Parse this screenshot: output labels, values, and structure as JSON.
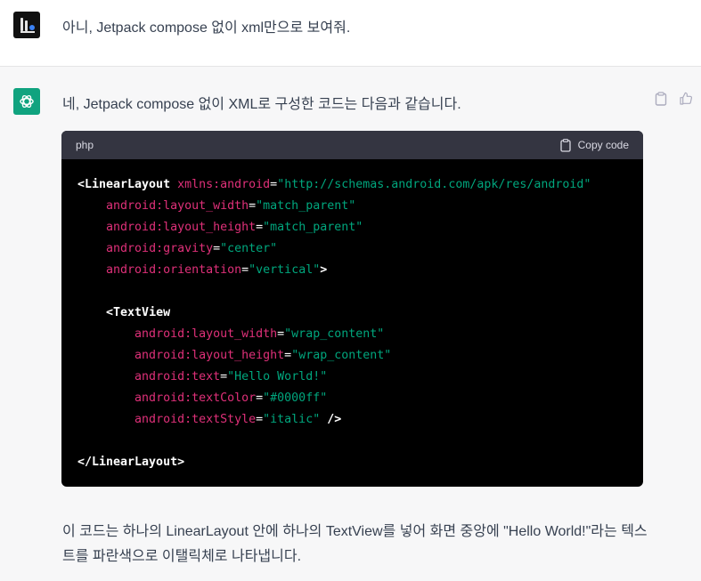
{
  "user": {
    "message": "아니, Jetpack compose 없이 xml만으로 보여줘."
  },
  "assistant": {
    "intro": "네, Jetpack compose 없이 XML로 구성한 코드는 다음과 같습니다.",
    "code": {
      "language": "php",
      "copy_label": "Copy code",
      "lines": [
        {
          "indent": "",
          "tokens": [
            {
              "t": "tag",
              "v": "<LinearLayout"
            },
            {
              "t": "punc",
              "v": " "
            },
            {
              "t": "attr",
              "v": "xmlns:android"
            },
            {
              "t": "punc",
              "v": "="
            },
            {
              "t": "str",
              "v": "\"http://schemas.android.com/apk/res/android\""
            }
          ]
        },
        {
          "indent": "    ",
          "tokens": [
            {
              "t": "attr",
              "v": "android:layout_width"
            },
            {
              "t": "punc",
              "v": "="
            },
            {
              "t": "str",
              "v": "\"match_parent\""
            }
          ]
        },
        {
          "indent": "    ",
          "tokens": [
            {
              "t": "attr",
              "v": "android:layout_height"
            },
            {
              "t": "punc",
              "v": "="
            },
            {
              "t": "str",
              "v": "\"match_parent\""
            }
          ]
        },
        {
          "indent": "    ",
          "tokens": [
            {
              "t": "attr",
              "v": "android:gravity"
            },
            {
              "t": "punc",
              "v": "="
            },
            {
              "t": "str",
              "v": "\"center\""
            }
          ]
        },
        {
          "indent": "    ",
          "tokens": [
            {
              "t": "attr",
              "v": "android:orientation"
            },
            {
              "t": "punc",
              "v": "="
            },
            {
              "t": "str",
              "v": "\"vertical\""
            },
            {
              "t": "tag",
              "v": ">"
            }
          ]
        },
        {
          "indent": "",
          "tokens": []
        },
        {
          "indent": "    ",
          "tokens": [
            {
              "t": "tag",
              "v": "<TextView"
            }
          ]
        },
        {
          "indent": "        ",
          "tokens": [
            {
              "t": "attr",
              "v": "android:layout_width"
            },
            {
              "t": "punc",
              "v": "="
            },
            {
              "t": "str",
              "v": "\"wrap_content\""
            }
          ]
        },
        {
          "indent": "        ",
          "tokens": [
            {
              "t": "attr",
              "v": "android:layout_height"
            },
            {
              "t": "punc",
              "v": "="
            },
            {
              "t": "str",
              "v": "\"wrap_content\""
            }
          ]
        },
        {
          "indent": "        ",
          "tokens": [
            {
              "t": "attr",
              "v": "android:text"
            },
            {
              "t": "punc",
              "v": "="
            },
            {
              "t": "str",
              "v": "\"Hello World!\""
            }
          ]
        },
        {
          "indent": "        ",
          "tokens": [
            {
              "t": "attr",
              "v": "android:textColor"
            },
            {
              "t": "punc",
              "v": "="
            },
            {
              "t": "str",
              "v": "\"#0000ff\""
            }
          ]
        },
        {
          "indent": "        ",
          "tokens": [
            {
              "t": "attr",
              "v": "android:textStyle"
            },
            {
              "t": "punc",
              "v": "="
            },
            {
              "t": "str",
              "v": "\"italic\""
            },
            {
              "t": "punc",
              "v": " "
            },
            {
              "t": "tag",
              "v": "/>"
            }
          ]
        },
        {
          "indent": "",
          "tokens": []
        },
        {
          "indent": "",
          "tokens": [
            {
              "t": "tag",
              "v": "</LinearLayout>"
            }
          ]
        }
      ]
    },
    "outro": "이 코드는 하나의 LinearLayout 안에 하나의 TextView를 넣어 화면 중앙에 \"Hello World!\"라는 텍스트를 파란색으로 이탤릭체로 나타냅니다."
  },
  "icons": {
    "user_avatar": "user-avatar-icon",
    "bot_avatar": "openai-logo-icon",
    "copy": "clipboard-icon",
    "thumbs_up": "thumbs-up-icon"
  },
  "colors": {
    "assistant_bg": "#f7f7f8",
    "bot_avatar_bg": "#10a37f",
    "code_bg": "#000000",
    "code_header_bg": "#343541",
    "attr": "#df3079",
    "string": "#00a67d"
  }
}
